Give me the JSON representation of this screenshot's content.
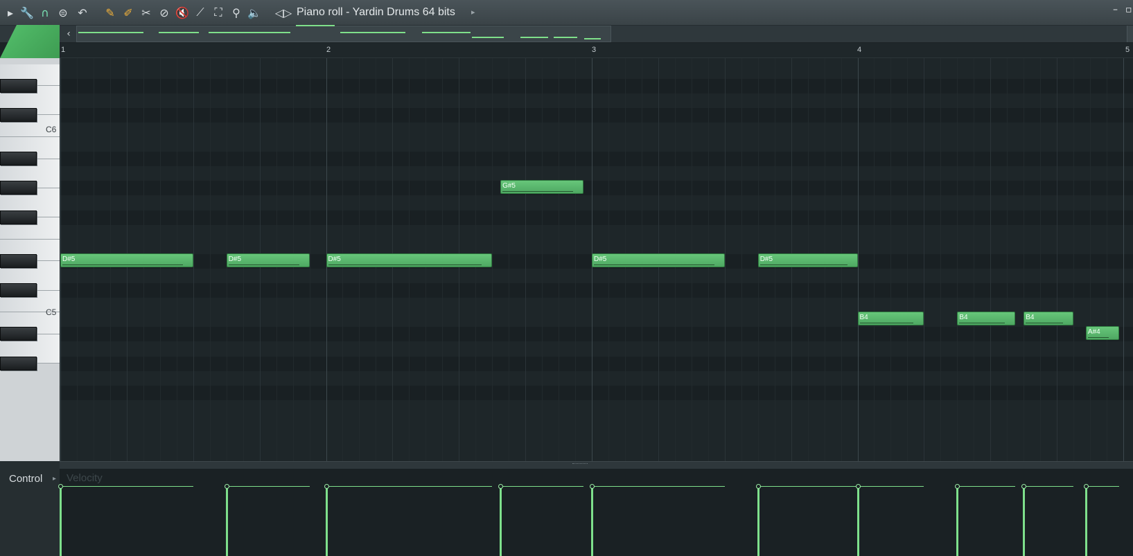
{
  "window": {
    "title": "Piano roll - Yardin Drums 64 bits",
    "minimize_icon": "minimize-icon",
    "restore_icon": "restore-icon"
  },
  "toolbar": {
    "tools": [
      {
        "name": "menu-arrow-icon",
        "glyph": "▸"
      },
      {
        "name": "wrench-icon",
        "glyph": "🔧"
      },
      {
        "name": "magnet-icon",
        "glyph": "∩"
      },
      {
        "name": "options-icon",
        "glyph": "⊜"
      },
      {
        "name": "undo-icon",
        "glyph": "↶"
      },
      {
        "name": "pencil-icon",
        "glyph": "✎"
      },
      {
        "name": "paint-brush-icon",
        "glyph": "✐"
      },
      {
        "name": "delete-tool-icon",
        "glyph": "✂"
      },
      {
        "name": "erase-icon",
        "glyph": "⊘"
      },
      {
        "name": "mute-icon",
        "glyph": "🔇"
      },
      {
        "name": "slice-icon",
        "glyph": "⟋"
      },
      {
        "name": "select-icon",
        "glyph": "⛶"
      },
      {
        "name": "zoom-icon",
        "glyph": "⚲"
      },
      {
        "name": "playback-icon",
        "glyph": "🔈"
      },
      {
        "name": "target-channel-icon",
        "glyph": "◁▷"
      }
    ]
  },
  "ruler": {
    "bars": [
      "1",
      "2",
      "3",
      "4",
      "5"
    ]
  },
  "keyboard": {
    "octave_labels": [
      "C6",
      "C5"
    ]
  },
  "notes": [
    {
      "label": "D#5",
      "pitch": "D#5",
      "start": 1.0,
      "length": 0.5
    },
    {
      "label": "D#5",
      "pitch": "D#5",
      "start": 1.625,
      "length": 0.3125
    },
    {
      "label": "D#5",
      "pitch": "D#5",
      "start": 2.0,
      "length": 0.625
    },
    {
      "label": "G#5",
      "pitch": "G#5",
      "start": 2.656,
      "length": 0.3125
    },
    {
      "label": "D#5",
      "pitch": "D#5",
      "start": 3.0,
      "length": 0.5
    },
    {
      "label": "D#5",
      "pitch": "D#5",
      "start": 3.625,
      "length": 0.375
    },
    {
      "label": "B4",
      "pitch": "B4",
      "start": 4.0,
      "length": 0.25
    },
    {
      "label": "B4",
      "pitch": "B4",
      "start": 4.375,
      "length": 0.219
    },
    {
      "label": "B4",
      "pitch": "B4",
      "start": 4.625,
      "length": 0.1875
    },
    {
      "label": "A#4",
      "pitch": "A#4",
      "start": 4.859,
      "length": 0.125
    }
  ],
  "control": {
    "label": "Control",
    "parameter": "Velocity"
  },
  "colors": {
    "note": "#5ab86d",
    "velocity": "#7ee08c",
    "tool_accent": "#f2b13a"
  }
}
